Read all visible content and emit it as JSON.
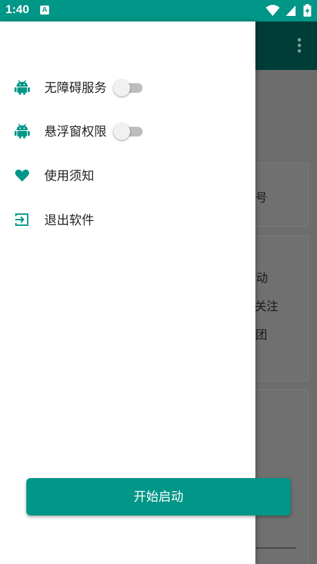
{
  "status_bar": {
    "time": "1:40",
    "notification_icon": "A",
    "icons": [
      "wifi-icon",
      "signal-icon",
      "battery-charging-icon"
    ]
  },
  "drawer": {
    "items": [
      {
        "label": "无障碍服务",
        "icon": "android-icon",
        "toggle": true,
        "toggle_on": false
      },
      {
        "label": "悬浮窗权限",
        "icon": "android-icon",
        "toggle": true,
        "toggle_on": false
      },
      {
        "label": "使用须知",
        "icon": "heart-icon",
        "toggle": false
      },
      {
        "label": "退出软件",
        "icon": "exit-icon",
        "toggle": false
      }
    ],
    "start_button_label": "开始启动"
  },
  "background_app": {
    "card1_text": "号",
    "card2_texts": [
      "动",
      "关注",
      "团"
    ]
  },
  "colors": {
    "accent": "#009688",
    "dark_toolbar": "#003d36",
    "scrim": "#6d6d6d"
  }
}
